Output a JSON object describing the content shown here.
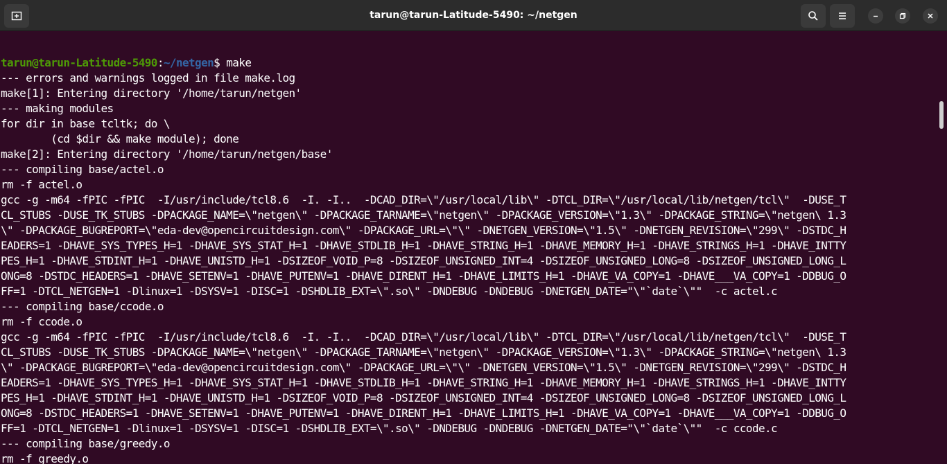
{
  "window": {
    "title": "tarun@tarun-Latitude-5490: ~/netgen"
  },
  "titlebar": {
    "new_tab_icon": "new-tab-icon",
    "search_icon": "search-icon",
    "menu_icon": "hamburger-menu-icon",
    "minimize_icon": "minimize-icon",
    "maximize_icon": "maximize-icon",
    "close_icon": "close-icon"
  },
  "terminal": {
    "colors": {
      "background": "#300a24",
      "text": "#ffffff",
      "user": "#4e9a06",
      "path": "#3465a4"
    },
    "top_rule": "---------------------------------------------------------------------------",
    "prompt": {
      "user": "tarun@tarun-Latitude-5490",
      "sep": ":",
      "path": "~/netgen",
      "dollar": "$ ",
      "command": "make"
    },
    "lines": [
      "--- errors and warnings logged in file make.log",
      "make[1]: Entering directory '/home/tarun/netgen'",
      "--- making modules",
      "for dir in base tcltk; do \\",
      "        (cd $dir && make module); done",
      "make[2]: Entering directory '/home/tarun/netgen/base'",
      "--- compiling base/actel.o",
      "rm -f actel.o",
      "gcc -g -m64 -fPIC -fPIC  -I/usr/include/tcl8.6  -I. -I..  -DCAD_DIR=\\\"/usr/local/lib\\\" -DTCL_DIR=\\\"/usr/local/lib/netgen/tcl\\\"  -DUSE_T",
      "CL_STUBS -DUSE_TK_STUBS -DPACKAGE_NAME=\\\"netgen\\\" -DPACKAGE_TARNAME=\\\"netgen\\\" -DPACKAGE_VERSION=\\\"1.3\\\" -DPACKAGE_STRING=\\\"netgen\\ 1.3",
      "\\\" -DPACKAGE_BUGREPORT=\\\"eda-dev@opencircuitdesign.com\\\" -DPACKAGE_URL=\\\"\\\" -DNETGEN_VERSION=\\\"1.5\\\" -DNETGEN_REVISION=\\\"299\\\" -DSTDC_H",
      "EADERS=1 -DHAVE_SYS_TYPES_H=1 -DHAVE_SYS_STAT_H=1 -DHAVE_STDLIB_H=1 -DHAVE_STRING_H=1 -DHAVE_MEMORY_H=1 -DHAVE_STRINGS_H=1 -DHAVE_INTTY",
      "PES_H=1 -DHAVE_STDINT_H=1 -DHAVE_UNISTD_H=1 -DSIZEOF_VOID_P=8 -DSIZEOF_UNSIGNED_INT=4 -DSIZEOF_UNSIGNED_LONG=8 -DSIZEOF_UNSIGNED_LONG_L",
      "ONG=8 -DSTDC_HEADERS=1 -DHAVE_SETENV=1 -DHAVE_PUTENV=1 -DHAVE_DIRENT_H=1 -DHAVE_LIMITS_H=1 -DHAVE_VA_COPY=1 -DHAVE___VA_COPY=1 -DDBUG_O",
      "FF=1 -DTCL_NETGEN=1 -Dlinux=1 -DSYSV=1 -DISC=1 -DSHDLIB_EXT=\\\".so\\\" -DNDEBUG -DNDEBUG -DNETGEN_DATE=\"\\\"`date`\\\"\"  -c actel.c",
      "--- compiling base/ccode.o",
      "rm -f ccode.o",
      "gcc -g -m64 -fPIC -fPIC  -I/usr/include/tcl8.6  -I. -I..  -DCAD_DIR=\\\"/usr/local/lib\\\" -DTCL_DIR=\\\"/usr/local/lib/netgen/tcl\\\"  -DUSE_T",
      "CL_STUBS -DUSE_TK_STUBS -DPACKAGE_NAME=\\\"netgen\\\" -DPACKAGE_TARNAME=\\\"netgen\\\" -DPACKAGE_VERSION=\\\"1.3\\\" -DPACKAGE_STRING=\\\"netgen\\ 1.3",
      "\\\" -DPACKAGE_BUGREPORT=\\\"eda-dev@opencircuitdesign.com\\\" -DPACKAGE_URL=\\\"\\\" -DNETGEN_VERSION=\\\"1.5\\\" -DNETGEN_REVISION=\\\"299\\\" -DSTDC_H",
      "EADERS=1 -DHAVE_SYS_TYPES_H=1 -DHAVE_SYS_STAT_H=1 -DHAVE_STDLIB_H=1 -DHAVE_STRING_H=1 -DHAVE_MEMORY_H=1 -DHAVE_STRINGS_H=1 -DHAVE_INTTY",
      "PES_H=1 -DHAVE_STDINT_H=1 -DHAVE_UNISTD_H=1 -DSIZEOF_VOID_P=8 -DSIZEOF_UNSIGNED_INT=4 -DSIZEOF_UNSIGNED_LONG=8 -DSIZEOF_UNSIGNED_LONG_L",
      "ONG=8 -DSTDC_HEADERS=1 -DHAVE_SETENV=1 -DHAVE_PUTENV=1 -DHAVE_DIRENT_H=1 -DHAVE_LIMITS_H=1 -DHAVE_VA_COPY=1 -DHAVE___VA_COPY=1 -DDBUG_O",
      "FF=1 -DTCL_NETGEN=1 -Dlinux=1 -DSYSV=1 -DISC=1 -DSHDLIB_EXT=\\\".so\\\" -DNDEBUG -DNDEBUG -DNETGEN_DATE=\"\\\"`date`\\\"\"  -c ccode.c",
      "--- compiling base/greedy.o",
      "rm -f greedy.o"
    ]
  }
}
